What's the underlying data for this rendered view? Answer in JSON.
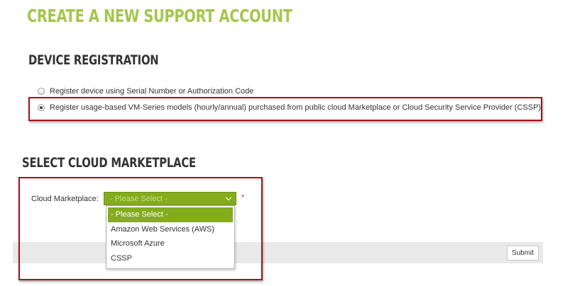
{
  "page": {
    "title": "CREATE A NEW SUPPORT ACCOUNT"
  },
  "device_registration": {
    "heading": "DEVICE REGISTRATION",
    "options": [
      {
        "label": "Register device using Serial Number or Authorization Code",
        "checked": false
      },
      {
        "label": "Register usage-based VM-Series models (hourly/annual) purchased from public cloud Marketplace or Cloud Security Service Provider (CSSP)",
        "checked": true
      }
    ]
  },
  "cloud_marketplace": {
    "heading": "SELECT CLOUD MARKETPLACE",
    "field_label": "Cloud Marketplace:",
    "selected_value": "- Please Select -",
    "required_marker": "*",
    "options": [
      "- Please Select -",
      "Amazon Web Services (AWS)",
      "Microsoft Azure",
      "CSSP"
    ]
  },
  "footer": {
    "submit_label": "Submit"
  },
  "colors": {
    "title_green": "#a6c64c",
    "select_green": "#84ac1c",
    "highlight_red": "#a3121b",
    "required_red": "#d0312d"
  }
}
